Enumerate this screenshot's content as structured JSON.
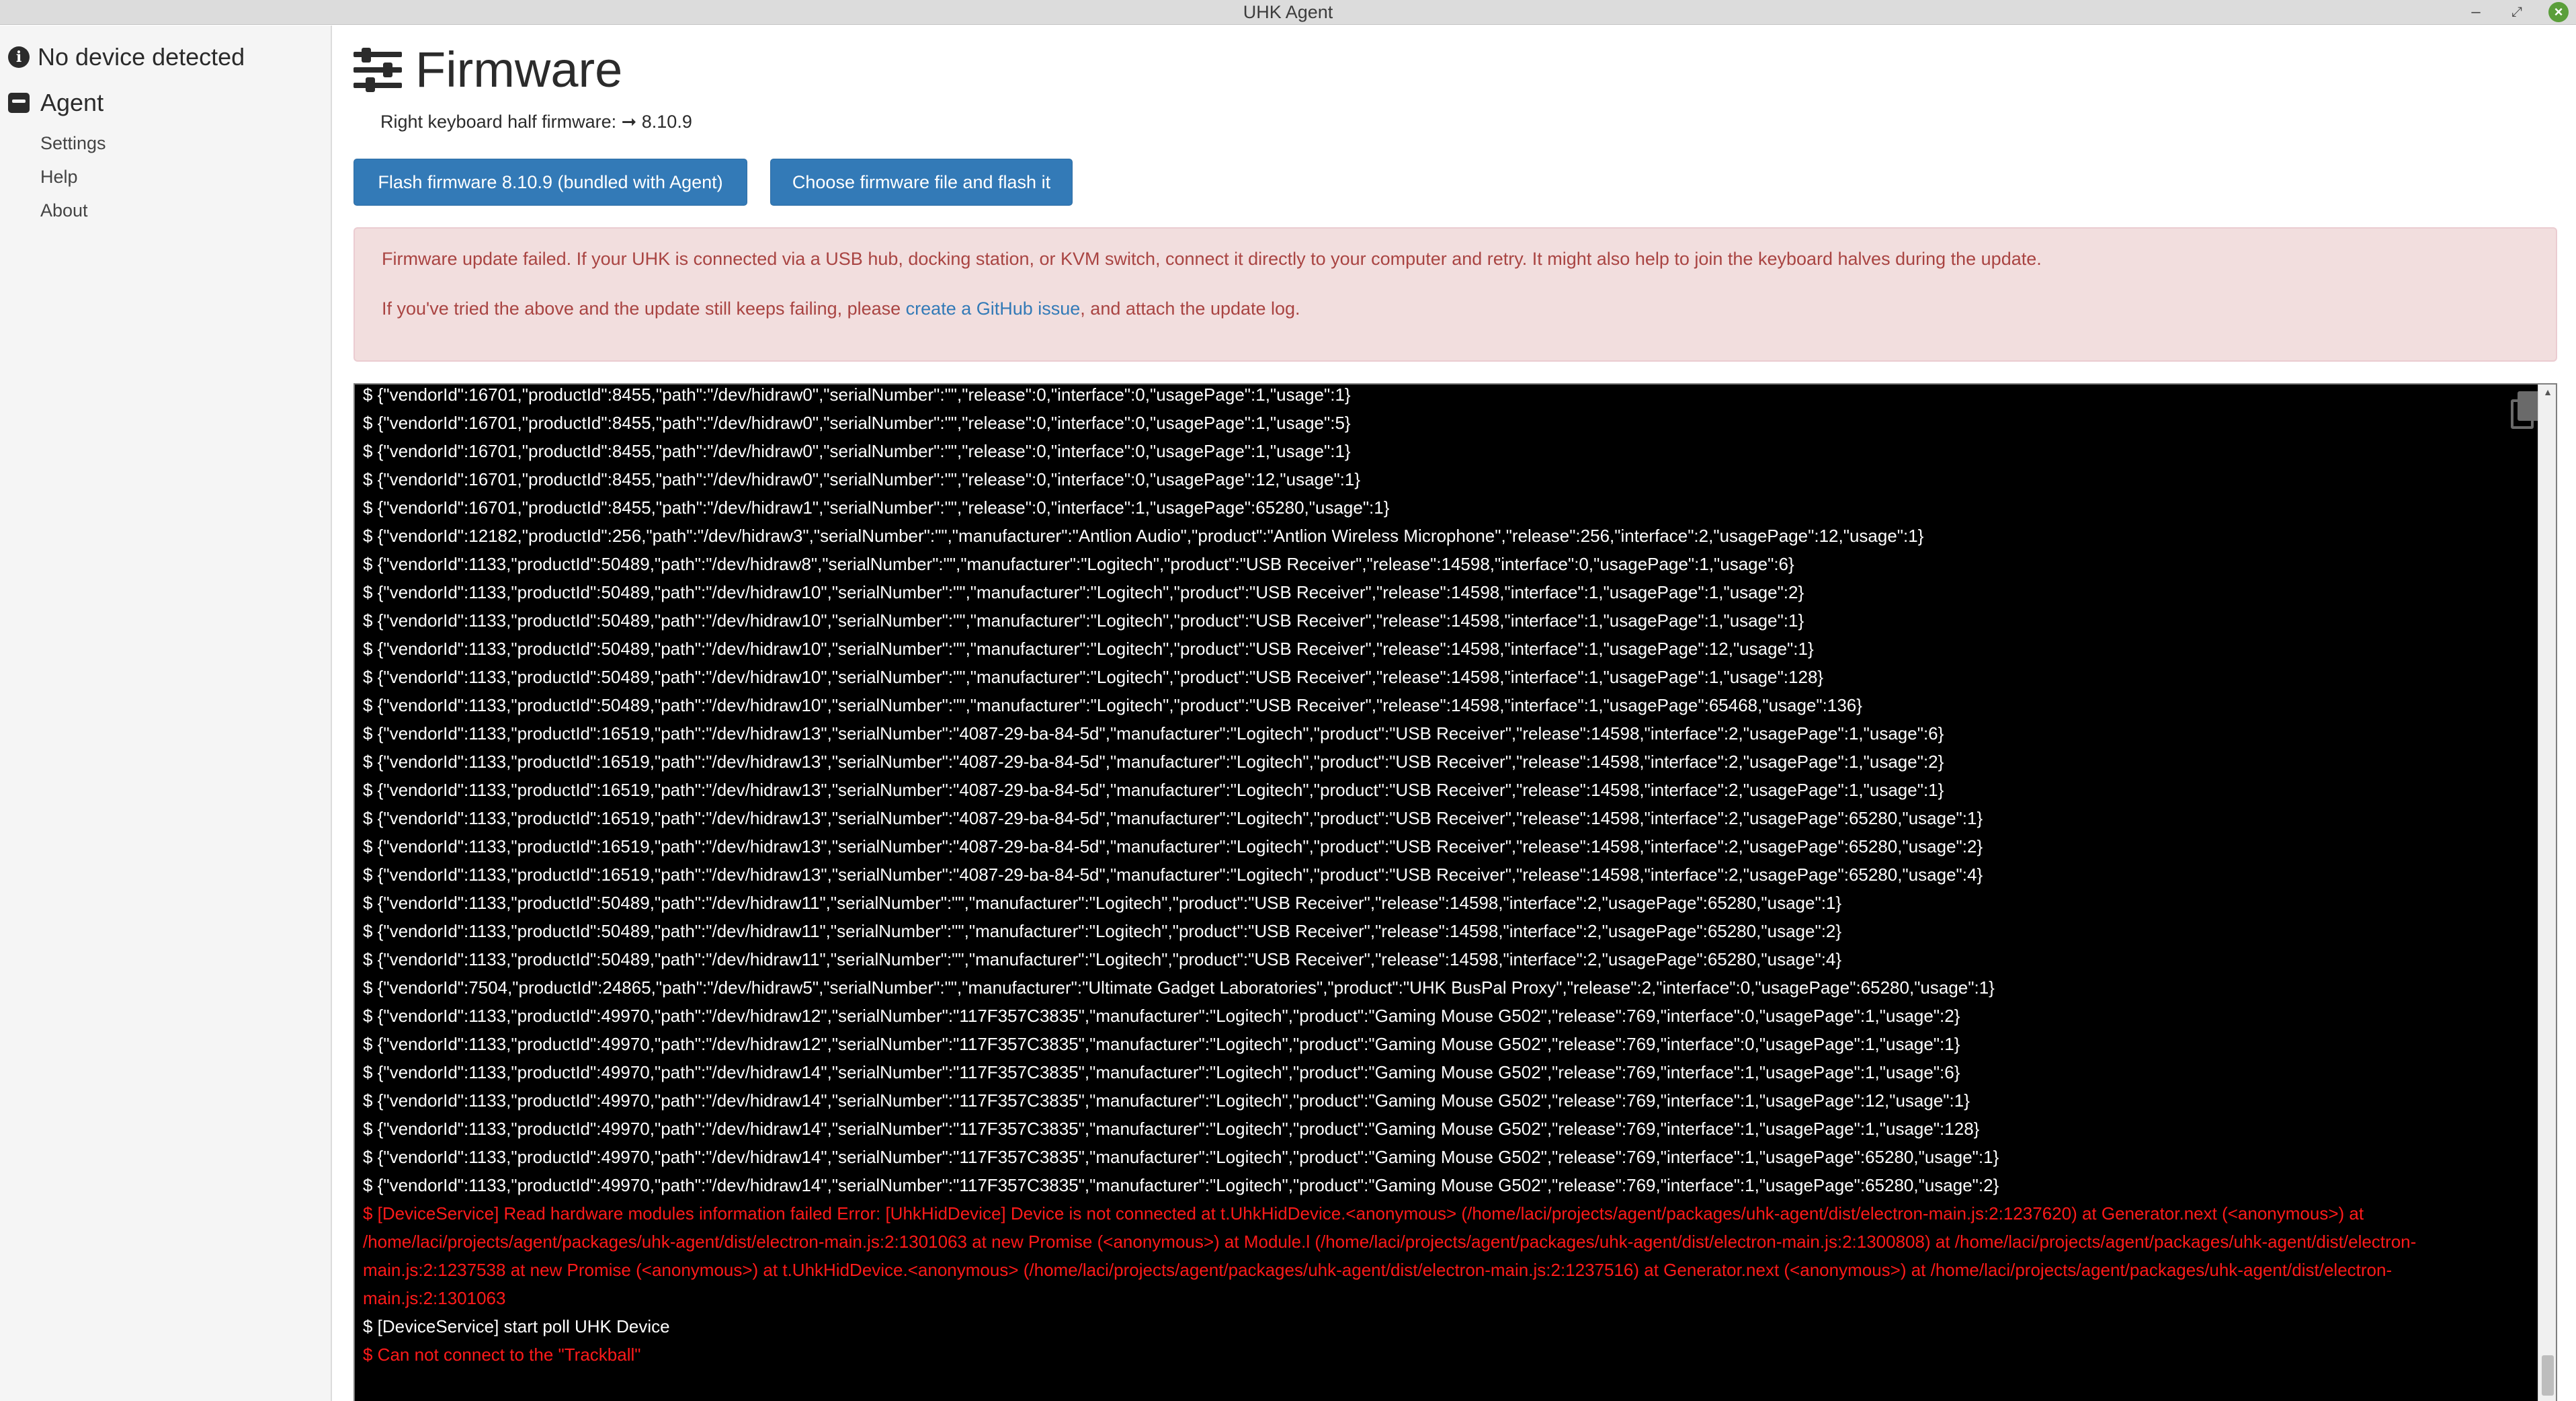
{
  "window": {
    "title": "UHK Agent",
    "minimize_glyph": "–",
    "maximize_glyph": "⤢",
    "close_glyph": "×",
    "close_color": "#5a9e3a"
  },
  "sidebar": {
    "device_status": "No device detected",
    "device_icon": "info-icon",
    "agent_label": "Agent",
    "agent_icon": "agent-icon",
    "links": [
      "Settings",
      "Help",
      "About"
    ]
  },
  "main": {
    "title": "Firmware",
    "title_icon": "sliders-icon",
    "firmware_version_text": "Right keyboard half firmware: ➞ 8.10.9",
    "buttons": {
      "flash": "Flash firmware 8.10.9 (bundled with Agent)",
      "choose": "Choose firmware file and flash it"
    },
    "alert": {
      "message": "Firmware update failed. If your UHK is connected via a USB hub, docking station, or KVM switch, connect it directly to your computer and retry. It might also help to join the keyboard halves during the update.",
      "help_before": "If you've tried the above and the update still keeps failing, please ",
      "help_link": "create a GitHub issue",
      "help_after": ", and attach the update log."
    },
    "log": {
      "copy_icon": "copy-icon",
      "lines": [
        {
          "text": "$ {\"vendorId\":16701,\"productId\":8455,\"path\":\"/dev/hidraw0\",\"serialNumber\":\"\",\"release\":0,\"interface\":0,\"usagePage\":1,\"usage\":1}",
          "error": false
        },
        {
          "text": "$ {\"vendorId\":16701,\"productId\":8455,\"path\":\"/dev/hidraw0\",\"serialNumber\":\"\",\"release\":0,\"interface\":0,\"usagePage\":1,\"usage\":5}",
          "error": false
        },
        {
          "text": "$ {\"vendorId\":16701,\"productId\":8455,\"path\":\"/dev/hidraw0\",\"serialNumber\":\"\",\"release\":0,\"interface\":0,\"usagePage\":1,\"usage\":1}",
          "error": false
        },
        {
          "text": "$ {\"vendorId\":16701,\"productId\":8455,\"path\":\"/dev/hidraw0\",\"serialNumber\":\"\",\"release\":0,\"interface\":0,\"usagePage\":12,\"usage\":1}",
          "error": false
        },
        {
          "text": "$ {\"vendorId\":16701,\"productId\":8455,\"path\":\"/dev/hidraw1\",\"serialNumber\":\"\",\"release\":0,\"interface\":1,\"usagePage\":65280,\"usage\":1}",
          "error": false
        },
        {
          "text": "$ {\"vendorId\":12182,\"productId\":256,\"path\":\"/dev/hidraw3\",\"serialNumber\":\"\",\"manufacturer\":\"Antlion Audio\",\"product\":\"Antlion Wireless Microphone\",\"release\":256,\"interface\":2,\"usagePage\":12,\"usage\":1}",
          "error": false
        },
        {
          "text": "$ {\"vendorId\":1133,\"productId\":50489,\"path\":\"/dev/hidraw8\",\"serialNumber\":\"\",\"manufacturer\":\"Logitech\",\"product\":\"USB Receiver\",\"release\":14598,\"interface\":0,\"usagePage\":1,\"usage\":6}",
          "error": false
        },
        {
          "text": "$ {\"vendorId\":1133,\"productId\":50489,\"path\":\"/dev/hidraw10\",\"serialNumber\":\"\",\"manufacturer\":\"Logitech\",\"product\":\"USB Receiver\",\"release\":14598,\"interface\":1,\"usagePage\":1,\"usage\":2}",
          "error": false
        },
        {
          "text": "$ {\"vendorId\":1133,\"productId\":50489,\"path\":\"/dev/hidraw10\",\"serialNumber\":\"\",\"manufacturer\":\"Logitech\",\"product\":\"USB Receiver\",\"release\":14598,\"interface\":1,\"usagePage\":1,\"usage\":1}",
          "error": false
        },
        {
          "text": "$ {\"vendorId\":1133,\"productId\":50489,\"path\":\"/dev/hidraw10\",\"serialNumber\":\"\",\"manufacturer\":\"Logitech\",\"product\":\"USB Receiver\",\"release\":14598,\"interface\":1,\"usagePage\":12,\"usage\":1}",
          "error": false
        },
        {
          "text": "$ {\"vendorId\":1133,\"productId\":50489,\"path\":\"/dev/hidraw10\",\"serialNumber\":\"\",\"manufacturer\":\"Logitech\",\"product\":\"USB Receiver\",\"release\":14598,\"interface\":1,\"usagePage\":1,\"usage\":128}",
          "error": false
        },
        {
          "text": "$ {\"vendorId\":1133,\"productId\":50489,\"path\":\"/dev/hidraw10\",\"serialNumber\":\"\",\"manufacturer\":\"Logitech\",\"product\":\"USB Receiver\",\"release\":14598,\"interface\":1,\"usagePage\":65468,\"usage\":136}",
          "error": false
        },
        {
          "text": "$ {\"vendorId\":1133,\"productId\":16519,\"path\":\"/dev/hidraw13\",\"serialNumber\":\"4087-29-ba-84-5d\",\"manufacturer\":\"Logitech\",\"product\":\"USB Receiver\",\"release\":14598,\"interface\":2,\"usagePage\":1,\"usage\":6}",
          "error": false
        },
        {
          "text": "$ {\"vendorId\":1133,\"productId\":16519,\"path\":\"/dev/hidraw13\",\"serialNumber\":\"4087-29-ba-84-5d\",\"manufacturer\":\"Logitech\",\"product\":\"USB Receiver\",\"release\":14598,\"interface\":2,\"usagePage\":1,\"usage\":2}",
          "error": false
        },
        {
          "text": "$ {\"vendorId\":1133,\"productId\":16519,\"path\":\"/dev/hidraw13\",\"serialNumber\":\"4087-29-ba-84-5d\",\"manufacturer\":\"Logitech\",\"product\":\"USB Receiver\",\"release\":14598,\"interface\":2,\"usagePage\":1,\"usage\":1}",
          "error": false
        },
        {
          "text": "$ {\"vendorId\":1133,\"productId\":16519,\"path\":\"/dev/hidraw13\",\"serialNumber\":\"4087-29-ba-84-5d\",\"manufacturer\":\"Logitech\",\"product\":\"USB Receiver\",\"release\":14598,\"interface\":2,\"usagePage\":65280,\"usage\":1}",
          "error": false
        },
        {
          "text": "$ {\"vendorId\":1133,\"productId\":16519,\"path\":\"/dev/hidraw13\",\"serialNumber\":\"4087-29-ba-84-5d\",\"manufacturer\":\"Logitech\",\"product\":\"USB Receiver\",\"release\":14598,\"interface\":2,\"usagePage\":65280,\"usage\":2}",
          "error": false
        },
        {
          "text": "$ {\"vendorId\":1133,\"productId\":16519,\"path\":\"/dev/hidraw13\",\"serialNumber\":\"4087-29-ba-84-5d\",\"manufacturer\":\"Logitech\",\"product\":\"USB Receiver\",\"release\":14598,\"interface\":2,\"usagePage\":65280,\"usage\":4}",
          "error": false
        },
        {
          "text": "$ {\"vendorId\":1133,\"productId\":50489,\"path\":\"/dev/hidraw11\",\"serialNumber\":\"\",\"manufacturer\":\"Logitech\",\"product\":\"USB Receiver\",\"release\":14598,\"interface\":2,\"usagePage\":65280,\"usage\":1}",
          "error": false
        },
        {
          "text": "$ {\"vendorId\":1133,\"productId\":50489,\"path\":\"/dev/hidraw11\",\"serialNumber\":\"\",\"manufacturer\":\"Logitech\",\"product\":\"USB Receiver\",\"release\":14598,\"interface\":2,\"usagePage\":65280,\"usage\":2}",
          "error": false
        },
        {
          "text": "$ {\"vendorId\":1133,\"productId\":50489,\"path\":\"/dev/hidraw11\",\"serialNumber\":\"\",\"manufacturer\":\"Logitech\",\"product\":\"USB Receiver\",\"release\":14598,\"interface\":2,\"usagePage\":65280,\"usage\":4}",
          "error": false
        },
        {
          "text": "$ {\"vendorId\":7504,\"productId\":24865,\"path\":\"/dev/hidraw5\",\"serialNumber\":\"\",\"manufacturer\":\"Ultimate Gadget Laboratories\",\"product\":\"UHK BusPal Proxy\",\"release\":2,\"interface\":0,\"usagePage\":65280,\"usage\":1}",
          "error": false
        },
        {
          "text": "$ {\"vendorId\":1133,\"productId\":49970,\"path\":\"/dev/hidraw12\",\"serialNumber\":\"117F357C3835\",\"manufacturer\":\"Logitech\",\"product\":\"Gaming Mouse G502\",\"release\":769,\"interface\":0,\"usagePage\":1,\"usage\":2}",
          "error": false
        },
        {
          "text": "$ {\"vendorId\":1133,\"productId\":49970,\"path\":\"/dev/hidraw12\",\"serialNumber\":\"117F357C3835\",\"manufacturer\":\"Logitech\",\"product\":\"Gaming Mouse G502\",\"release\":769,\"interface\":0,\"usagePage\":1,\"usage\":1}",
          "error": false
        },
        {
          "text": "$ {\"vendorId\":1133,\"productId\":49970,\"path\":\"/dev/hidraw14\",\"serialNumber\":\"117F357C3835\",\"manufacturer\":\"Logitech\",\"product\":\"Gaming Mouse G502\",\"release\":769,\"interface\":1,\"usagePage\":1,\"usage\":6}",
          "error": false
        },
        {
          "text": "$ {\"vendorId\":1133,\"productId\":49970,\"path\":\"/dev/hidraw14\",\"serialNumber\":\"117F357C3835\",\"manufacturer\":\"Logitech\",\"product\":\"Gaming Mouse G502\",\"release\":769,\"interface\":1,\"usagePage\":12,\"usage\":1}",
          "error": false
        },
        {
          "text": "$ {\"vendorId\":1133,\"productId\":49970,\"path\":\"/dev/hidraw14\",\"serialNumber\":\"117F357C3835\",\"manufacturer\":\"Logitech\",\"product\":\"Gaming Mouse G502\",\"release\":769,\"interface\":1,\"usagePage\":1,\"usage\":128}",
          "error": false
        },
        {
          "text": "$ {\"vendorId\":1133,\"productId\":49970,\"path\":\"/dev/hidraw14\",\"serialNumber\":\"117F357C3835\",\"manufacturer\":\"Logitech\",\"product\":\"Gaming Mouse G502\",\"release\":769,\"interface\":1,\"usagePage\":65280,\"usage\":1}",
          "error": false
        },
        {
          "text": "$ {\"vendorId\":1133,\"productId\":49970,\"path\":\"/dev/hidraw14\",\"serialNumber\":\"117F357C3835\",\"manufacturer\":\"Logitech\",\"product\":\"Gaming Mouse G502\",\"release\":769,\"interface\":1,\"usagePage\":65280,\"usage\":2}",
          "error": false
        },
        {
          "text": "$ [DeviceService] Read hardware modules information failed Error: [UhkHidDevice] Device is not connected at t.UhkHidDevice.<anonymous> (/home/laci/projects/agent/packages/uhk-agent/dist/electron-main.js:2:1237620) at Generator.next (<anonymous>) at /home/laci/projects/agent/packages/uhk-agent/dist/electron-main.js:2:1301063 at new Promise (<anonymous>) at Module.l (/home/laci/projects/agent/packages/uhk-agent/dist/electron-main.js:2:1300808) at /home/laci/projects/agent/packages/uhk-agent/dist/electron-main.js:2:1237538 at new Promise (<anonymous>) at t.UhkHidDevice.<anonymous> (/home/laci/projects/agent/packages/uhk-agent/dist/electron-main.js:2:1237516) at Generator.next (<anonymous>) at /home/laci/projects/agent/packages/uhk-agent/dist/electron-main.js:2:1301063",
          "error": true
        },
        {
          "text": "$ [DeviceService] start poll UHK Device",
          "error": false
        },
        {
          "text": "$ Can not connect to the \"Trackball\"",
          "error": true
        }
      ]
    }
  }
}
